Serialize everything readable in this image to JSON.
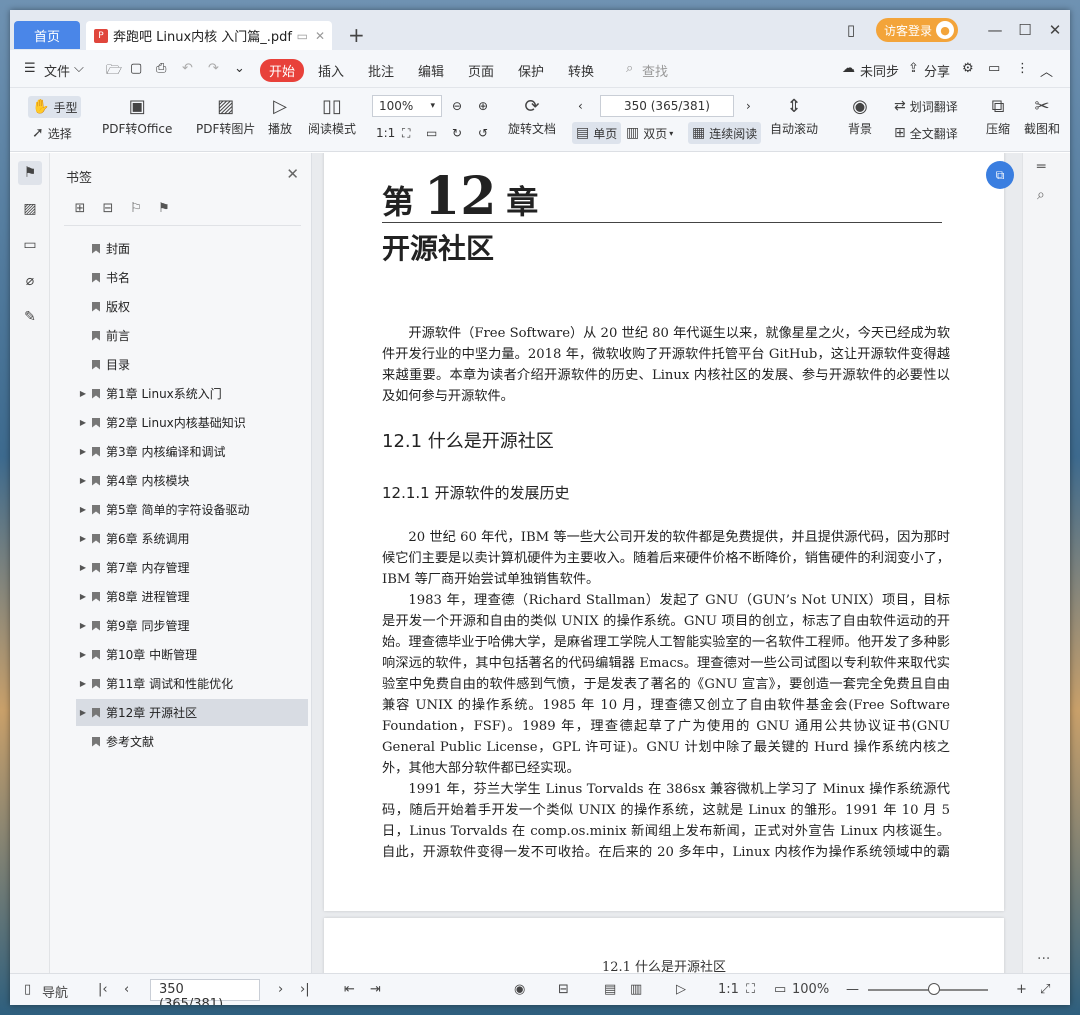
{
  "window": {
    "home_tab": "首页",
    "doc_tab": "奔跑吧 Linux内核 入门篇_.pdf",
    "login": "访客登录"
  },
  "menu": {
    "file": "文件",
    "items": [
      "开始",
      "插入",
      "批注",
      "编辑",
      "页面",
      "保护",
      "转换"
    ],
    "search": "查找",
    "sync": "未同步",
    "share": "分享"
  },
  "toolbar": {
    "hand": "手型",
    "select": "选择",
    "pdf_office": "PDF转Office",
    "pdf_image": "PDF转图片",
    "play": "播放",
    "read_mode": "阅读模式",
    "zoom": "100%",
    "page_input": "350 (365/381)",
    "rotate": "旋转文档",
    "single": "单页",
    "double": "双页",
    "continuous": "连续阅读",
    "auto_scroll": "自动滚动",
    "background": "背景",
    "translate": "划词翻译",
    "full_translate": "全文翻译",
    "compress": "压缩",
    "screenshot": "截图和"
  },
  "panel": {
    "title": "书签",
    "bookmarks": [
      {
        "label": "封面",
        "expandable": false
      },
      {
        "label": "书名",
        "expandable": false
      },
      {
        "label": "版权",
        "expandable": false
      },
      {
        "label": "前言",
        "expandable": false
      },
      {
        "label": "目录",
        "expandable": false
      },
      {
        "label": "第1章  Linux系统入门",
        "expandable": true
      },
      {
        "label": "第2章  Linux内核基础知识",
        "expandable": true
      },
      {
        "label": "第3章  内核编译和调试",
        "expandable": true
      },
      {
        "label": "第4章  内核模块",
        "expandable": true
      },
      {
        "label": "第5章  简单的字符设备驱动",
        "expandable": true
      },
      {
        "label": "第6章  系统调用",
        "expandable": true
      },
      {
        "label": "第7章  内存管理",
        "expandable": true
      },
      {
        "label": "第8章  进程管理",
        "expandable": true
      },
      {
        "label": "第9章  同步管理",
        "expandable": true
      },
      {
        "label": "第10章  中断管理",
        "expandable": true
      },
      {
        "label": "第11章  调试和性能优化",
        "expandable": true
      },
      {
        "label": "第12章  开源社区",
        "expandable": true,
        "selected": true
      },
      {
        "label": "参考文献",
        "expandable": false
      }
    ]
  },
  "page": {
    "chapter_prefix": "第",
    "chapter_num": "12",
    "chapter_suffix": "章",
    "chapter_title": "开源社区",
    "intro": "开源软件（Free Software）从 20 世纪 80 年代诞生以来，就像星星之火，今天已经成为软件开发行业的中坚力量。2018 年，微软收购了开源软件托管平台 GitHub，这让开源软件变得越来越重要。本章为读者介绍开源软件的历史、Linux 内核社区的发展、参与开源软件的必要性以及如何参与开源软件。",
    "h2": "12.1   什么是开源社区",
    "h3": "12.1.1   开源软件的发展历史",
    "p1": "20 世纪 60 年代，IBM 等一些大公司开发的软件都是免费提供，并且提供源代码，因为那时候它们主要是以卖计算机硬件为主要收入。随着后来硬件价格不断降价，销售硬件的利润变小了，IBM 等厂商开始尝试单独销售软件。",
    "p2": "1983 年，理查德（Richard Stallman）发起了 GNU（GUN’s Not UNIX）项目，目标是开发一个开源和自由的类似 UNIX 的操作系统。GNU 项目的创立，标志了自由软件运动的开始。理查德毕业于哈佛大学，是麻省理工学院人工智能实验室的一名软件工程师。他开发了多种影响深远的软件，其中包括著名的代码编辑器 Emacs。理查德对一些公司试图以专利软件来取代实验室中免费自由的软件感到气愤，于是发表了著名的《GNU 宣言》，要创造一套完全免费且自由兼容 UNIX 的操作系统。1985 年 10 月，理查德又创立了自由软件基金会(Free Software Foundation，FSF)。1989 年，理查德起草了广为使用的 GNU 通用公共协议证书(GNU General Public License，GPL 许可证)。GNU 计划中除了最关键的 Hurd 操作系统内核之外，其他大部分软件都已经实现。",
    "p3": "1991 年，芬兰大学生 Linus Torvalds 在 386sx 兼容微机上学习了 Minux 操作系统源代码，随后开始着手开发一个类似 UNIX 的操作系统，这就是 Linux 的雏形。1991 年 10 月 5 日，Linus Torvalds 在 comp.os.minix 新闻组上发布新闻，正式对外宣告 Linux 内核诞生。自此，开源软件变得一发不可收拾。在后来的 20 多年中，Linux 内核作为操作系统领域中的霸主，",
    "next_header": "12.1   什么是开源社区"
  },
  "status": {
    "nav": "导航",
    "page": "350 (365/381)",
    "zoom": "100%",
    "zoom_fraction": 0.55
  }
}
